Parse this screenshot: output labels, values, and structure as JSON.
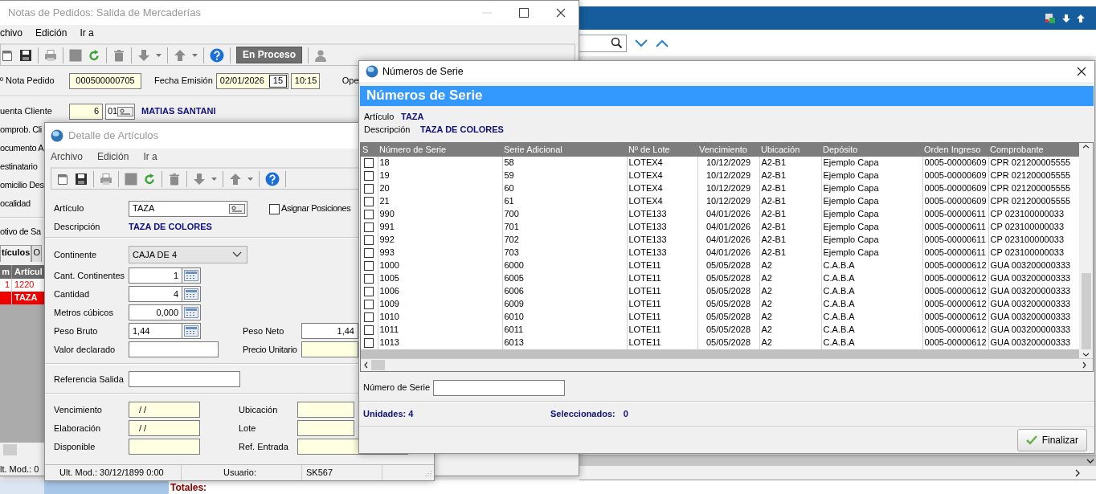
{
  "back_app": {
    "totals_label": "Totales:"
  },
  "orders_window": {
    "title": "Notas de Pedidos: Salida de Mercaderías",
    "menu": [
      "chivo",
      "Edición",
      "Ir a"
    ],
    "status_button": "En Proceso",
    "order_number": {
      "label": "º Nota Pedido",
      "value": "000500000705"
    },
    "issue_date": {
      "label": "Fecha Emisión",
      "value": "02/01/2026",
      "calendar": "15",
      "time": "10:15"
    },
    "operator_label": "Ope",
    "customer": {
      "label": "uenta Cliente",
      "code": "6",
      "branch": "01",
      "name": "MATIAS SANTANI"
    },
    "side_labels": [
      "omprob. Cli",
      "ocumento A",
      "estinatario",
      "omicilio Des",
      "ocalidad"
    ],
    "reason_label": "otivo de Sa",
    "tabs": [
      {
        "label": "tículos",
        "selected": true
      },
      {
        "label": "O",
        "selected": false
      }
    ],
    "grid": {
      "columns": [
        "m",
        "Artícul"
      ],
      "rows": [
        {
          "item": "1",
          "article": "1220",
          "selected": false
        },
        {
          "article": "TAZA",
          "selected": true
        }
      ]
    },
    "status_text": "lt. Mod.: 0"
  },
  "detail_window": {
    "title": "Detalle de Artículos",
    "menu": [
      "Archivo",
      "Edición",
      "Ir a"
    ],
    "article": {
      "label": "Artículo",
      "value": "TAZA"
    },
    "assign_positions": {
      "label": "Asignar Posiciones",
      "checked": false
    },
    "description": {
      "label": "Descripción",
      "value": "TAZA DE COLORES"
    },
    "container": {
      "label": "Continente",
      "value": "CAJA DE 4"
    },
    "quantities": [
      {
        "label": "Cant. Continentes",
        "value": "1"
      },
      {
        "label": "Cantidad",
        "value": "4"
      },
      {
        "label": "Metros cúbicos",
        "value": "0,000"
      }
    ],
    "gross_weight": {
      "label": "Peso Bruto",
      "value": "1,44"
    },
    "net_weight": {
      "label": "Peso Neto",
      "value": "1,44"
    },
    "declared_value": {
      "label": "Valor declarado"
    },
    "unit_price": {
      "label": "Precio Unitario"
    },
    "output_reference": {
      "label": "Referencia Salida"
    },
    "left_fields": [
      {
        "label": "Vencimiento",
        "value": "/ /"
      },
      {
        "label": "Elaboración",
        "value": "/ /"
      },
      {
        "label": "Disponible"
      }
    ],
    "right_fields": [
      {
        "label": "Ubicación"
      },
      {
        "label": "Lote"
      },
      {
        "label": "Ref. Entrada"
      }
    ],
    "status_bar": {
      "modified": "Ult. Mod.: 30/12/1899 0:00",
      "user_label": "Usuario:",
      "user": "SK567"
    }
  },
  "serial_window": {
    "title": "Números de Serie",
    "header": "Números de Serie",
    "article": {
      "label": "Artículo",
      "value": "TAZA"
    },
    "description": {
      "label": "Descripción",
      "value": "TAZA DE COLORES"
    },
    "check_column": "S",
    "columns": [
      "Número de Serie",
      "Serie Adicional",
      "Nº de Lote",
      "Vencimiento",
      "Ubicación",
      "Depósito",
      "Orden Ingreso",
      "Comprobante"
    ],
    "rows": [
      {
        "checked": false,
        "cells": [
          "18",
          "58",
          "LOTEX4",
          "10/12/2029",
          "A2-B1",
          "Ejemplo Capa",
          "0005-00000609",
          "CPR 021200005555"
        ]
      },
      {
        "checked": false,
        "cells": [
          "19",
          "59",
          "LOTEX4",
          "10/12/2029",
          "A2-B1",
          "Ejemplo Capa",
          "0005-00000609",
          "CPR 021200005555"
        ]
      },
      {
        "checked": false,
        "cells": [
          "20",
          "60",
          "LOTEX4",
          "10/12/2029",
          "A2-B1",
          "Ejemplo Capa",
          "0005-00000609",
          "CPR 021200005555"
        ]
      },
      {
        "checked": false,
        "cells": [
          "21",
          "61",
          "LOTEX4",
          "10/12/2029",
          "A2-B1",
          "Ejemplo Capa",
          "0005-00000609",
          "CPR 021200005555"
        ]
      },
      {
        "checked": false,
        "cells": [
          "990",
          "700",
          "LOTE133",
          "04/01/2026",
          "A2-B1",
          "Ejemplo Capa",
          "0005-00000611",
          "CP 023100000033"
        ]
      },
      {
        "checked": false,
        "cells": [
          "991",
          "701",
          "LOTE133",
          "04/01/2026",
          "A2-B1",
          "Ejemplo Capa",
          "0005-00000611",
          "CP 023100000033"
        ]
      },
      {
        "checked": false,
        "cells": [
          "992",
          "702",
          "LOTE133",
          "04/01/2026",
          "A2-B1",
          "Ejemplo Capa",
          "0005-00000611",
          "CP 023100000033"
        ]
      },
      {
        "checked": false,
        "cells": [
          "993",
          "703",
          "LOTE133",
          "04/01/2026",
          "A2-B1",
          "Ejemplo Capa",
          "0005-00000611",
          "CP 023100000033"
        ]
      },
      {
        "checked": false,
        "cells": [
          "1000",
          "6000",
          "LOTE11",
          "05/05/2028",
          "A2",
          "C.A.B.A",
          "0005-00000612",
          "GUA 003200000333"
        ]
      },
      {
        "checked": false,
        "cells": [
          "1005",
          "6005",
          "LOTE11",
          "05/05/2028",
          "A2",
          "C.A.B.A",
          "0005-00000612",
          "GUA 003200000333"
        ]
      },
      {
        "checked": false,
        "cells": [
          "1006",
          "6006",
          "LOTE11",
          "05/05/2028",
          "A2",
          "C.A.B.A",
          "0005-00000612",
          "GUA 003200000333"
        ]
      },
      {
        "checked": false,
        "cells": [
          "1009",
          "6009",
          "LOTE11",
          "05/05/2028",
          "A2",
          "C.A.B.A",
          "0005-00000612",
          "GUA 003200000333"
        ]
      },
      {
        "checked": false,
        "cells": [
          "1010",
          "6010",
          "LOTE11",
          "05/05/2028",
          "A2",
          "C.A.B.A",
          "0005-00000612",
          "GUA 003200000333"
        ]
      },
      {
        "checked": false,
        "cells": [
          "1011",
          "6011",
          "LOTE11",
          "05/05/2028",
          "A2",
          "C.A.B.A",
          "0005-00000612",
          "GUA 003200000333"
        ]
      },
      {
        "checked": false,
        "cells": [
          "1013",
          "6013",
          "LOTE11",
          "05/05/2028",
          "A2",
          "C.A.B.A",
          "0005-00000612",
          "GUA 003200000333"
        ]
      }
    ],
    "search": {
      "label": "Número de Serie"
    },
    "units": "Unidades: 4",
    "selected_label": "Seleccionados:",
    "selected_count": "0",
    "finish_button": "Finalizar"
  }
}
